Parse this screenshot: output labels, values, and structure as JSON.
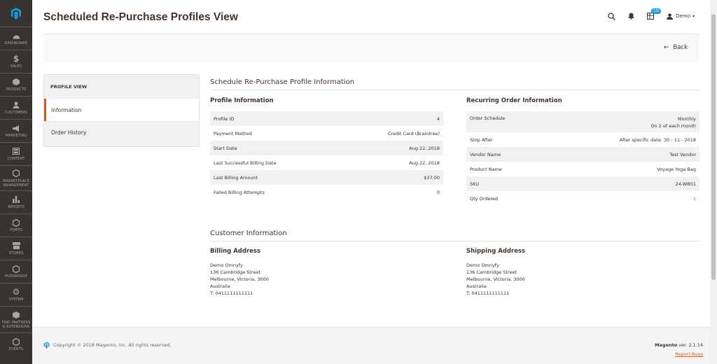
{
  "menu": [
    {
      "label": "DASHBOARD",
      "icon": "dashboard-icon"
    },
    {
      "label": "SALES",
      "icon": "dollar-icon"
    },
    {
      "label": "PRODUCTS",
      "icon": "box-icon"
    },
    {
      "label": "CUSTOMERS",
      "icon": "user-icon"
    },
    {
      "label": "MARKETING",
      "icon": "megaphone-icon"
    },
    {
      "label": "CONTENT",
      "icon": "layout-icon"
    },
    {
      "label": "MARKETPLACE MANAGEMENT",
      "icon": "hexagon-icon"
    },
    {
      "label": "REPORTS",
      "icon": "bar-chart-icon"
    },
    {
      "label": "PORTO",
      "icon": "hexagon-icon"
    },
    {
      "label": "STORES",
      "icon": "store-icon"
    },
    {
      "label": "PUSHASSIST",
      "icon": "hexagon-icon"
    },
    {
      "label": "SYSTEM",
      "icon": "gear-icon"
    },
    {
      "label": "FIND PARTNERS & EXTENSIONS",
      "icon": "cube-icon"
    },
    {
      "label": "EVENTS",
      "icon": "hexagon-icon"
    }
  ],
  "header": {
    "title": "Scheduled Re-Purchase Profiles View",
    "notification_count": "1/0",
    "user_name": "Demo"
  },
  "actions": {
    "back_label": "Back"
  },
  "tabs": {
    "title": "PROFILE VIEW",
    "information": "Information",
    "order_history": "Order History"
  },
  "schedule_section": {
    "title": "Schedule Re-Purchase Profile Information",
    "profile_info": {
      "title": "Profile Information",
      "rows": [
        {
          "label": "Profile ID",
          "value": "4"
        },
        {
          "label": "Payment Method",
          "value": "Credit Card (Braintree)"
        },
        {
          "label": "Start Date",
          "value": "Aug 22, 2018"
        },
        {
          "label": "Last Successful Billing Date",
          "value": "Aug 22, 2018"
        },
        {
          "label": "Last Billing Amount",
          "value": "$37.00"
        },
        {
          "label": "Failed Billing Attempts",
          "value": "0"
        }
      ]
    },
    "recurring_info": {
      "title": "Recurring Order Information",
      "order_schedule_label": "Order Schedule",
      "order_schedule_value1": "Monthly",
      "order_schedule_value2": "On 2 of each month",
      "rows": [
        {
          "label": "Stop After",
          "value": "After specific date: 30 - 11 - 2018"
        },
        {
          "label": "Vendor Name",
          "value": "Test Vendor"
        },
        {
          "label": "Product Name",
          "value": "Voyage Yoga Bag"
        },
        {
          "label": "SKU",
          "value": "24-WB01"
        },
        {
          "label": "Qty Ordered",
          "value": "1"
        }
      ]
    }
  },
  "customer_section": {
    "title": "Customer Information",
    "billing": {
      "title": "Billing Address",
      "name": "Demo Omnyfy",
      "street": "136 Cambridge Street",
      "city": "Melbourne, Victoria, 3000",
      "country": "Australia",
      "phone": "T: 0411111111111"
    },
    "shipping": {
      "title": "Shipping Address",
      "name": "Demo Omnyfy",
      "street": "136 Cambridge Street",
      "city": "Melbourne, Victoria, 3000",
      "country": "Australia",
      "phone": "T: 0411111111111"
    }
  },
  "footer": {
    "copyright": "Copyright © 2018 Magento, Inc. All rights reserved.",
    "brand": "Magento",
    "version": "ver. 2.1.14",
    "report_bugs": "Report Bugs"
  },
  "colors": {
    "accent": "#eb5202",
    "sidebar": "#373330",
    "logo": "#1a9dd6"
  }
}
